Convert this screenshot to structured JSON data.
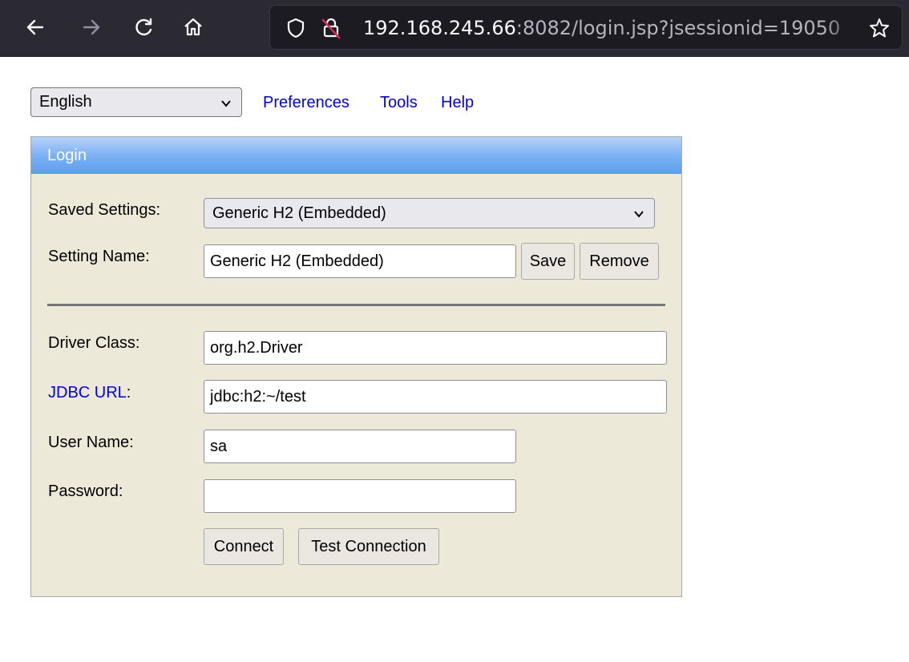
{
  "browser": {
    "url_host": "192.168.245.66",
    "url_rest": ":8082/login.jsp?jsessionid=19050",
    "icons": [
      "back-icon",
      "forward-icon",
      "reload-icon",
      "home-icon",
      "shield-icon",
      "insecure-lock-icon",
      "bookmark-star-icon"
    ]
  },
  "topbar": {
    "language": "English",
    "links": [
      "Preferences",
      "Tools",
      "Help"
    ]
  },
  "login": {
    "title": "Login",
    "saved_settings_label": "Saved Settings:",
    "saved_settings_value": "Generic H2 (Embedded)",
    "setting_name_label": "Setting Name:",
    "setting_name_value": "Generic H2 (Embedded)",
    "save_label": "Save",
    "remove_label": "Remove",
    "driver_class_label": "Driver Class:",
    "driver_class_value": "org.h2.Driver",
    "jdbc_url_link": "JDBC URL",
    "jdbc_url_colon": ":",
    "jdbc_url_value": "jdbc:h2:~/test",
    "user_name_label": "User Name:",
    "user_name_value": "sa",
    "password_label": "Password:",
    "password_value": "",
    "connect_label": "Connect",
    "test_connection_label": "Test Connection"
  }
}
